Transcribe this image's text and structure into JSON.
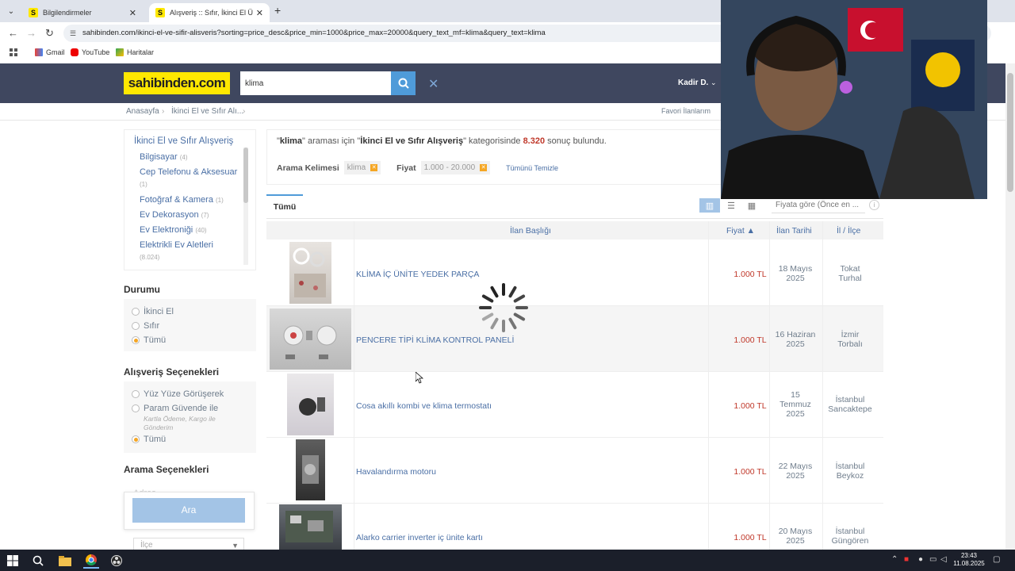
{
  "browser": {
    "tabs": [
      {
        "label": "Bilgilendirmeler",
        "favicon": "S"
      },
      {
        "label": "Alışveriş :: Sıfır, İkinci El Ürünler",
        "favicon": "S"
      }
    ],
    "url": "sahibinden.com/ikinci-el-ve-sifir-alisveris?sorting=price_desc&price_min=1000&price_max=20000&query_text_mf=klima&query_text=klima",
    "bookmarks": [
      "Gmail",
      "YouTube",
      "Haritalar"
    ]
  },
  "header": {
    "logo": "sahibinden.com",
    "search_value": "klima",
    "user_name": "Kadir D."
  },
  "breadcrumb": {
    "items": [
      "Anasayfa",
      "İkinci El ve Sıfır Alı..."
    ],
    "favorites_link": "Favori İlanlarım"
  },
  "sidebar": {
    "category_title": "İkinci El ve Sıfır Alışveriş",
    "categories": [
      {
        "label": "Bilgisayar",
        "count": "(4)"
      },
      {
        "label": "Cep Telefonu & Aksesuar",
        "count": "(1)"
      },
      {
        "label": "Fotoğraf & Kamera",
        "count": "(1)"
      },
      {
        "label": "Ev Dekorasyon",
        "count": "(7)"
      },
      {
        "label": "Ev Elektroniği",
        "count": "(40)"
      },
      {
        "label": "Elektrikli Ev Aletleri",
        "count": "(8.024)"
      }
    ],
    "condition_title": "Durumu",
    "condition_options": [
      "İkinci El",
      "Sıfır",
      "Tümü"
    ],
    "shopping_title": "Alışveriş Seçenekleri",
    "shopping_options": [
      "Yüz Yüze Görüşerek",
      "Param Güvende ile",
      "Tümü"
    ],
    "param_sub": "Kartla Ödeme, Kargo ile Gönderim",
    "search_options_title": "Arama Seçenekleri",
    "address_placeholder": "Adres",
    "search_button": "Ara",
    "ilce_placeholder": "İlçe"
  },
  "summary": {
    "q_open": "\"",
    "query": "klima",
    "mid1": "\" araması için \"",
    "category": "İkinci El ve Sıfır Alışveriş",
    "mid2": "\" kategorisinde",
    "count": "8.320",
    "tail": "sonuç bulundu."
  },
  "filters": {
    "keyword_label": "Arama Kelimesi",
    "keyword_value": "klima",
    "price_label": "Fiyat",
    "price_value": "1.000 - 20.000",
    "clear_all": "Tümünü Temizle"
  },
  "tabs": {
    "all": "Tümü"
  },
  "sort": {
    "value": "Fiyata göre (Önce en ..."
  },
  "table": {
    "headers": {
      "title": "İlan Başlığı",
      "price": "Fiyat ▲",
      "date": "İlan Tarihi",
      "loc": "İl / İlçe"
    },
    "rows": [
      {
        "title": "KLİMA İÇ ÜNİTE YEDEK PARÇA",
        "price": "1.000 TL",
        "date1": "18 Mayıs",
        "date2": "2025",
        "date3": "",
        "loc1": "Tokat",
        "loc2": "Turhal"
      },
      {
        "title": "PENCERE TİPİ KLİMA KONTROL PANELİ",
        "price": "1.000 TL",
        "date1": "16 Haziran",
        "date2": "2025",
        "date3": "",
        "loc1": "İzmir",
        "loc2": "Torbalı"
      },
      {
        "title": "Cosa akıllı kombi ve klima termostatı",
        "price": "1.000 TL",
        "date1": "15",
        "date2": "Temmuz",
        "date3": "2025",
        "loc1": "İstanbul",
        "loc2": "Sancaktepe"
      },
      {
        "title": "Havalandırma motoru",
        "price": "1.000 TL",
        "date1": "22 Mayıs",
        "date2": "2025",
        "date3": "",
        "loc1": "İstanbul",
        "loc2": "Beykoz"
      },
      {
        "title": "Alarko carrier inverter iç ünite kartı",
        "price": "1.000 TL",
        "date1": "20 Mayıs",
        "date2": "2025",
        "date3": "",
        "loc1": "İstanbul",
        "loc2": "Güngören"
      }
    ]
  },
  "taskbar": {
    "time": "23:43",
    "date": "11.08.2025"
  }
}
